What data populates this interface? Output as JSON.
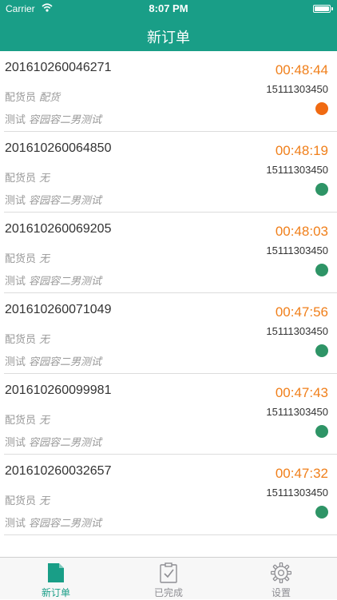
{
  "status_bar": {
    "carrier": "Carrier",
    "time": "8:07 PM"
  },
  "nav": {
    "title": "新订单"
  },
  "colors": {
    "theme": "#199e87",
    "elapsed": "#f07f1a",
    "dot_green": "#2e9466",
    "dot_orange": "#f06a12"
  },
  "orders": [
    {
      "id": "201610260046271",
      "picker_label": "配货员",
      "picker_value": "配货",
      "customer_label": "测试",
      "customer_value": "容园容二男测试",
      "elapsed": "00:48:44",
      "phone": "15111303450",
      "status": "orange"
    },
    {
      "id": "201610260064850",
      "picker_label": "配货员",
      "picker_value": "无",
      "customer_label": "测试",
      "customer_value": "容园容二男测试",
      "elapsed": "00:48:19",
      "phone": "15111303450",
      "status": "green"
    },
    {
      "id": "201610260069205",
      "picker_label": "配货员",
      "picker_value": "无",
      "customer_label": "测试",
      "customer_value": "容园容二男测试",
      "elapsed": "00:48:03",
      "phone": "15111303450",
      "status": "green"
    },
    {
      "id": "201610260071049",
      "picker_label": "配货员",
      "picker_value": "无",
      "customer_label": "测试",
      "customer_value": "容园容二男测试",
      "elapsed": "00:47:56",
      "phone": "15111303450",
      "status": "green"
    },
    {
      "id": "201610260099981",
      "picker_label": "配货员",
      "picker_value": "无",
      "customer_label": "测试",
      "customer_value": "容园容二男测试",
      "elapsed": "00:47:43",
      "phone": "15111303450",
      "status": "green"
    },
    {
      "id": "201610260032657",
      "picker_label": "配货员",
      "picker_value": "无",
      "customer_label": "测试",
      "customer_value": "容园容二男测试",
      "elapsed": "00:47:32",
      "phone": "15111303450",
      "status": "green"
    }
  ],
  "tabs": [
    {
      "label": "新订单",
      "icon": "document-icon",
      "active": true
    },
    {
      "label": "已完成",
      "icon": "clipboard-check-icon",
      "active": false
    },
    {
      "label": "设置",
      "icon": "gear-icon",
      "active": false
    }
  ]
}
